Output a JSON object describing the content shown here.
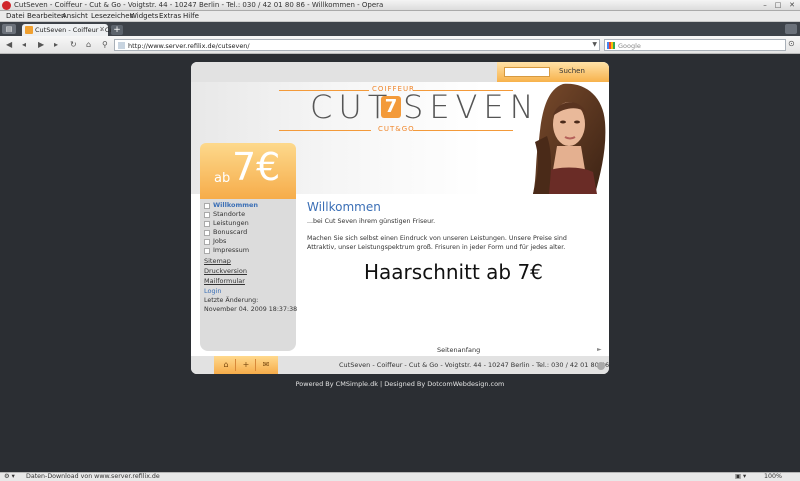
{
  "window": {
    "title": "CutSeven - Coiffeur - Cut & Go - Voigtstr. 44 - 10247 Berlin - Tel.: 030 / 42 01 80 86 - Willkommen - Opera",
    "minimize": "–",
    "maximize": "□",
    "close": "✕"
  },
  "menu": [
    "Datei",
    "Bearbeiten",
    "Ansicht",
    "Lesezeichen",
    "Widgets",
    "Extras",
    "Hilfe"
  ],
  "tab": {
    "label": "CutSeven - Coiffeur - Cu...",
    "close": "×",
    "new": "+"
  },
  "address": {
    "url": "http://www.server.refilix.de/cutseven/",
    "search_placeholder": "Google"
  },
  "site": {
    "search_button": "Suchen",
    "logo": {
      "top": "COIFFEUR",
      "left": "CUT",
      "mark": "7",
      "right": "SEVEN",
      "bottom": "CUT&GO"
    },
    "price": {
      "prefix": "ab",
      "amount": "7€"
    },
    "nav": [
      "Willkommen",
      "Standorte",
      "Leistungen",
      "Bonuscard",
      "Jobs",
      "Impressum"
    ],
    "links": [
      "Sitemap",
      "Druckversion",
      "Mailformular"
    ],
    "login": "Login",
    "last_change_label": "Letzte Änderung:",
    "last_change_date": "November 04. 2009 18:37:38",
    "heading": "Willkommen",
    "intro": "...bei Cut Seven ihrem günstigen Friseur.",
    "body": "Machen Sie sich selbst einen Eindruck von unseren Leistungen. Unsere Preise sind Attraktiv, unser Leistungspektrum groß. Frisuren in jeder Form und für jedes alter.",
    "headline": "Haarschnitt ab 7€",
    "to_top": "Seitenanfang",
    "footer": "CutSeven - Coiffeur - Cut & Go - Voigtstr. 44 - 10247 Berlin - Tel.: 030 / 42 01 80 86",
    "powered": "Powered By CMSimple.dk | Designed By DotcomWebdesign.com"
  },
  "status": {
    "text": "Daten-Download von www.server.refilix.de",
    "zoom": "100%"
  },
  "colors": {
    "accent": "#f39a3a",
    "link": "#3b6fb6",
    "page_bg": "#2b2e33"
  },
  "icons": [
    "opera-icon",
    "panel-toggle-icon",
    "back-icon",
    "forward-icon",
    "reload-icon",
    "home-icon",
    "wand-icon",
    "home-footer-icon",
    "plus-footer-icon",
    "mail-footer-icon"
  ]
}
